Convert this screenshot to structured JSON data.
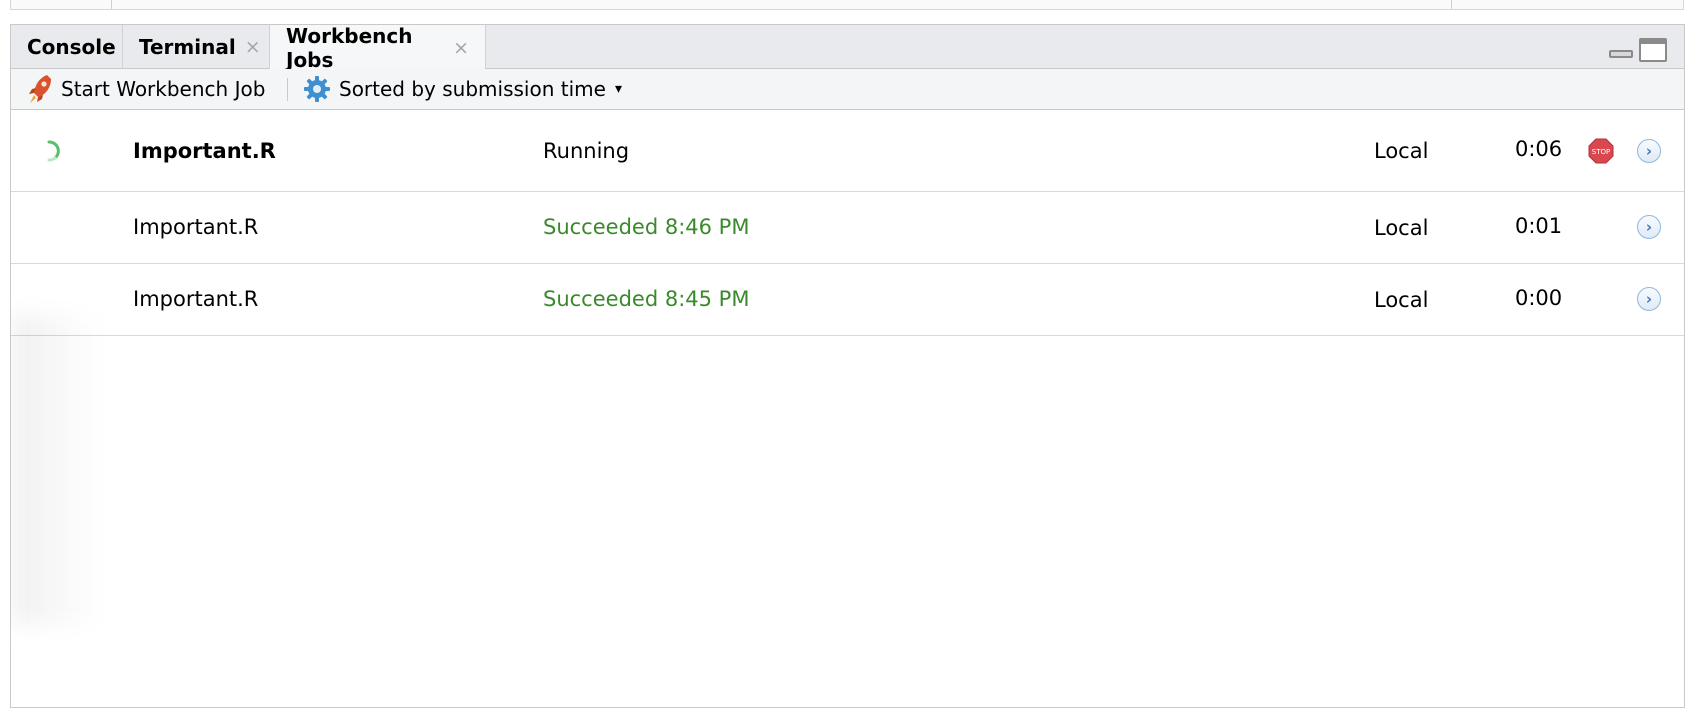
{
  "tabs": [
    {
      "label": "Console",
      "closable": false,
      "active": false
    },
    {
      "label": "Terminal",
      "closable": true,
      "active": false
    },
    {
      "label": "Workbench Jobs",
      "closable": true,
      "active": true
    }
  ],
  "tab_close_glyph": "×",
  "toolbar": {
    "start_job_label": "Start Workbench Job",
    "start_job_icon": "rocket-icon",
    "sort_label": "Sorted by submission time",
    "sort_icon": "gear-icon",
    "sort_caret": "▾"
  },
  "jobs": [
    {
      "name": "Important.R",
      "status": "Running",
      "location": "Local",
      "elapsed": "0:06",
      "running": true,
      "stop_label": "STOP"
    },
    {
      "name": "Important.R",
      "status": "Succeeded 8:46 PM",
      "location": "Local",
      "elapsed": "0:01",
      "running": false
    },
    {
      "name": "Important.R",
      "status": "Succeeded 8:45 PM",
      "location": "Local",
      "elapsed": "0:00",
      "running": false
    }
  ],
  "colors": {
    "succeeded": "#3a8a2c",
    "stop": "#d9484f",
    "spinner": "#5bbf6a",
    "rocket": "#d9532e",
    "gear": "#3f8fd0"
  }
}
